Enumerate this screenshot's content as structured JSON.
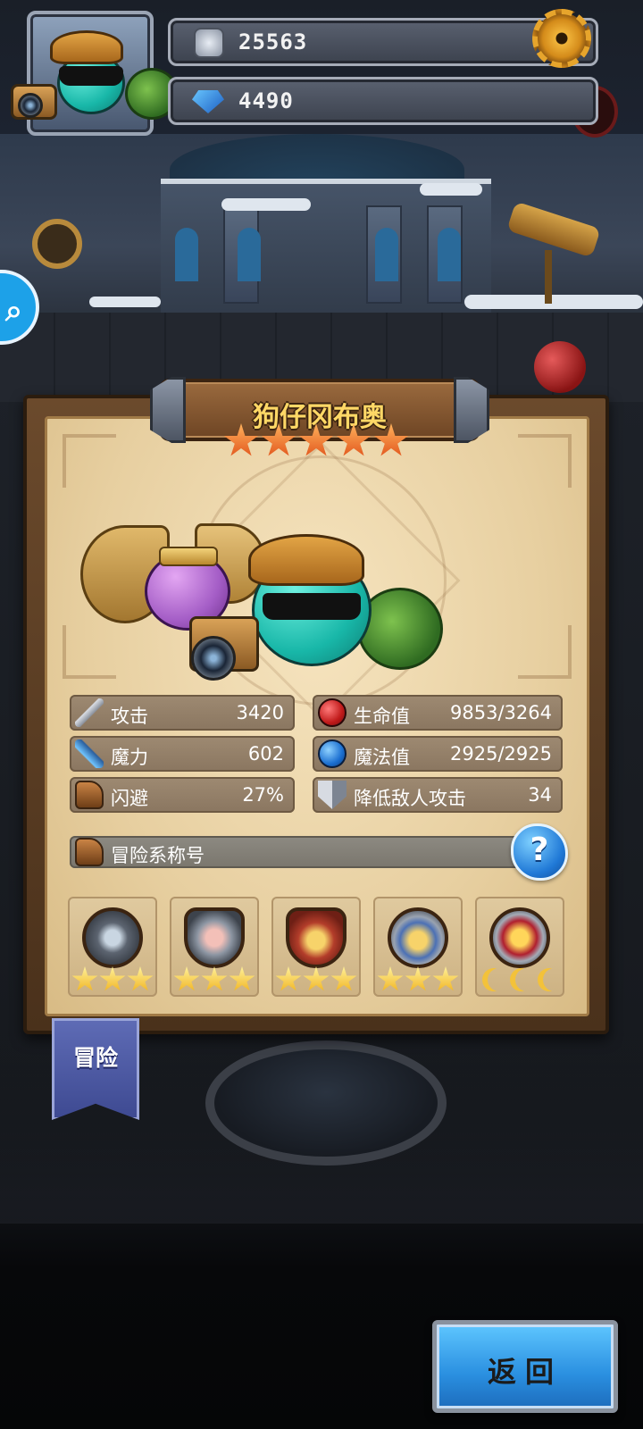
{
  "hud": {
    "coins": "25563",
    "gems": "4490",
    "settings_icon": "gear-icon",
    "search_icon": "magnifier-icon"
  },
  "panel": {
    "pet_name": "狗仔冈布奥",
    "rarity_stars": 5,
    "stats": [
      {
        "icon": "sword-icon",
        "label": "攻击",
        "value": "3420"
      },
      {
        "icon": "red-potion-icon",
        "label": "生命值",
        "value": "9853/3264"
      },
      {
        "icon": "staff-icon",
        "label": "魔力",
        "value": "602"
      },
      {
        "icon": "blue-potion-icon",
        "label": "魔法值",
        "value": "2925/2925"
      },
      {
        "icon": "boot-icon",
        "label": "闪避",
        "value": "27%"
      },
      {
        "icon": "shield-icon",
        "label": "降低敌人攻击",
        "value": "34"
      }
    ],
    "title_section": {
      "icon": "boot-badge-icon",
      "label": "冒险系称号",
      "help_label": "?"
    },
    "medals": [
      {
        "icon": "telescope-medal-icon",
        "stars": 3
      },
      {
        "icon": "portrait-shield-medal-icon",
        "stars": 3
      },
      {
        "icon": "treasure-bag-medal-icon",
        "stars": 3
      },
      {
        "icon": "laurel-gold-medal-icon",
        "stars": 3
      },
      {
        "icon": "crown-trophy-medal-icon",
        "stars": 3
      }
    ]
  },
  "category_banner": "冒险",
  "back_button": "返回",
  "colors": {
    "accent_blue": "#2a8fe0",
    "star_orange": "#e0521a",
    "title_gold": "#ffd866",
    "parchment": "#f6e4bf"
  }
}
